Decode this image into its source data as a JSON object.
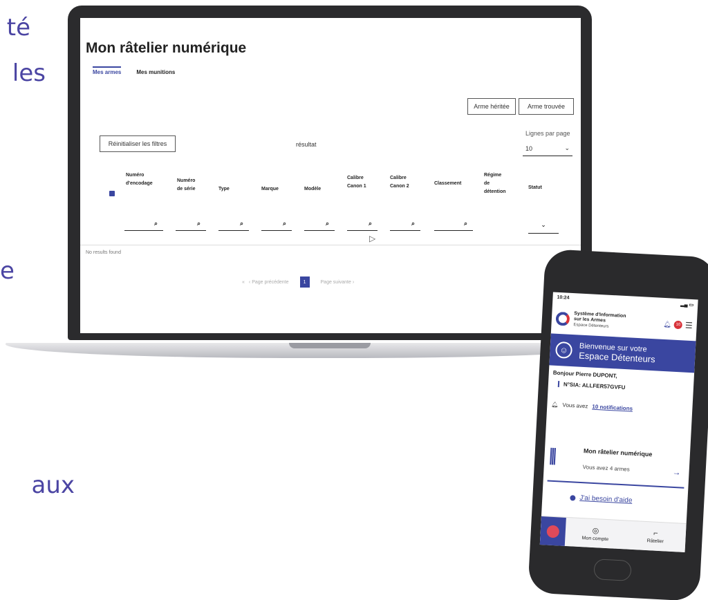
{
  "slide_fragments": [
    "té",
    "les",
    "e",
    "aux"
  ],
  "laptop": {
    "title": "Mon râtelier numérique",
    "tabs": [
      {
        "label": "Mes armes",
        "active": true
      },
      {
        "label": "Mes munitions",
        "active": false
      }
    ],
    "buttons": {
      "arme_heritee": "Arme héritée",
      "arme_trouvee": "Arme trouvée",
      "reinit": "Réinitialiser les filtres"
    },
    "result_label": "résultat",
    "lines_per_page_label": "Lignes par page",
    "lines_per_page_value": "10",
    "columns": [
      {
        "l1": "Numéro",
        "l2": "d'encodage"
      },
      {
        "l1": "Numéro",
        "l2": "de série"
      },
      {
        "l1": "Type",
        "l2": ""
      },
      {
        "l1": "Marque",
        "l2": ""
      },
      {
        "l1": "Modèle",
        "l2": ""
      },
      {
        "l1": "Calibre",
        "l2": "Canon 1"
      },
      {
        "l1": "Calibre",
        "l2": "Canon 2"
      },
      {
        "l1": "Classement",
        "l2": ""
      },
      {
        "l1": "Régime",
        "l2": "de",
        "l3": "détention"
      },
      {
        "l1": "Statut",
        "l2": ""
      }
    ],
    "no_results": "No results found",
    "pager": {
      "prev": "Page précédente",
      "current": "1",
      "next": "Page suivante"
    },
    "accent": "#3a46a0"
  },
  "phone": {
    "time": "10:24",
    "app_name": "Système d'Information",
    "app_name2": "sur les Armes",
    "app_sub": "Espace Détenteurs",
    "badge_count": "10",
    "welcome_l1": "Bienvenue sur votre",
    "welcome_l2": "Espace Détenteurs",
    "hello": "Bonjour Pierre DUPONT,",
    "sia": "N°SIA: ALLFER57GVFU",
    "notif_prefix": "Vous avez",
    "notif_link": "10 notifications",
    "card_title": "Mon râtelier numérique",
    "card_sub": "Vous avez 4 armes",
    "help": "J'ai besoin d'aide",
    "nav": {
      "account": "Mon compte",
      "rack": "Râtelier"
    }
  }
}
